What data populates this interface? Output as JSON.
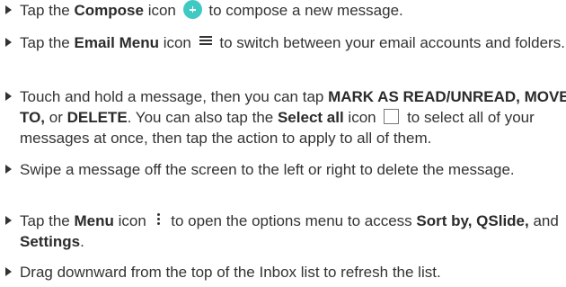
{
  "items": [
    {
      "parts": [
        "Tap the ",
        "Compose",
        " icon",
        " to compose a new message."
      ]
    },
    {
      "parts": [
        "Tap the ",
        "Email Menu",
        " icon",
        " to switch between your email accounts and folders."
      ]
    },
    {
      "parts": [
        "Touch and hold a message, then you can tap ",
        "MARK AS READ/UNREAD,",
        " ",
        "MOVE TO,",
        " or ",
        "DELETE",
        ". You can also tap the ",
        "Select all",
        " icon",
        " to select all of your messages at once, then tap the action to apply to all of them."
      ]
    },
    {
      "parts": [
        "Swipe a message off the screen to the left or right to delete the message."
      ]
    },
    {
      "parts": [
        "Tap the ",
        "Menu",
        " icon",
        " to open the options menu to access ",
        "Sort by,",
        " ",
        "QSlide,",
        " and ",
        "Settings",
        "."
      ]
    },
    {
      "parts": [
        "Drag downward from the top of the Inbox list to refresh the list."
      ]
    }
  ],
  "icons": {
    "compose": "compose-icon",
    "email_menu": "email-menu-icon",
    "select_all": "checkbox-icon",
    "menu": "more-vertical-icon"
  },
  "colors": {
    "compose_icon": "#3fc9c2",
    "text": "#333333"
  }
}
